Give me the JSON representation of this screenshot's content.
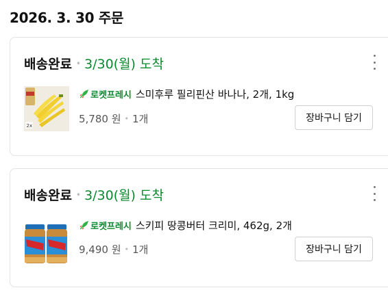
{
  "order": {
    "date_label": "2026. 3. 30 주문"
  },
  "shipments": [
    {
      "status": "배송완료",
      "arrival": "3/30(월) 도착",
      "badge": "로켓프레시",
      "product_name": "스미후루 필리핀산 바나나, 2개, 1kg",
      "price": "5,780 원",
      "quantity": "1개",
      "cart_button": "장바구니 담기",
      "thumb_tag": "2x",
      "image": "banana-product-image"
    },
    {
      "status": "배송완료",
      "arrival": "3/30(월) 도착",
      "badge": "로켓프레시",
      "product_name": "스키피 땅콩버터 크리미, 462g, 2개",
      "price": "9,490 원",
      "quantity": "1개",
      "cart_button": "장바구니 담기",
      "image": "peanut-butter-product-image"
    }
  ],
  "colors": {
    "arrival_green": "#0a8a2e",
    "border": "#e3e3e3",
    "rocket_green": "#2fb344"
  }
}
